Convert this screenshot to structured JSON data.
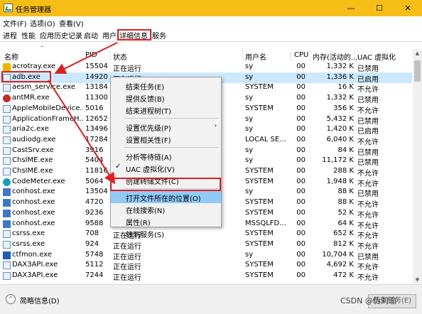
{
  "window": {
    "title": "任务管理器",
    "minimize": "—",
    "maximize": "☐",
    "close": "✕"
  },
  "menu": [
    "文件(F)",
    "选项(O)",
    "查看(V)"
  ],
  "tabs": [
    "进程",
    "性能",
    "应用历史记录",
    "启动",
    "用户",
    "详细信息",
    "服务"
  ],
  "active_tab": "详细信息",
  "columns": [
    "名称",
    "PID",
    "状态",
    "用户名",
    "CPU",
    "内存(活动的...",
    "UAC 虚拟化"
  ],
  "rows": [
    {
      "icon": "ri-yel",
      "name": "acrotray.exe",
      "pid": "15504",
      "status": "正在运行",
      "user": "sy",
      "cpu": "00",
      "mem": "1,332 K",
      "uac": "已禁用"
    },
    {
      "icon": "ri-gen",
      "name": "adb.exe",
      "pid": "14920",
      "status": "正在运行",
      "user": "sy",
      "cpu": "00",
      "mem": "1,336 K",
      "uac": "已启用",
      "selected": true
    },
    {
      "icon": "ri-gen",
      "name": "aesm_service.exe",
      "pid": "13184",
      "status": "",
      "user": "SYSTEM",
      "cpu": "00",
      "mem": "16 K",
      "uac": "不允许"
    },
    {
      "icon": "ri-red",
      "name": "antMR.exe",
      "pid": "11300",
      "status": "",
      "user": "sy",
      "cpu": "00",
      "mem": "1,332 K",
      "uac": "已禁用"
    },
    {
      "icon": "ri-gen",
      "name": "AppleMobileDevice...",
      "pid": "5016",
      "status": "",
      "user": "SYSTEM",
      "cpu": "00",
      "mem": "356 K",
      "uac": "不允许"
    },
    {
      "icon": "ri-gen",
      "name": "ApplicationFrameH...",
      "pid": "12652",
      "status": "",
      "user": "sy",
      "cpu": "00",
      "mem": "5,432 K",
      "uac": "已禁用"
    },
    {
      "icon": "ri-gen",
      "name": "aria2c.exe",
      "pid": "13496",
      "status": "",
      "user": "sy",
      "cpu": "00",
      "mem": "1,420 K",
      "uac": "已启用"
    },
    {
      "icon": "ri-gen",
      "name": "audiodg.exe",
      "pid": "17284",
      "status": "",
      "user": "LOCAL SE...",
      "cpu": "00",
      "mem": "6,040 K",
      "uac": "不允许"
    },
    {
      "icon": "ri-gen",
      "name": "CastSrv.exe",
      "pid": "3916",
      "status": "",
      "user": "sy",
      "cpu": "00",
      "mem": "84 K",
      "uac": "已禁用"
    },
    {
      "icon": "ri-gen",
      "name": "ChsIME.exe",
      "pid": "5404",
      "status": "",
      "user": "sy",
      "cpu": "00",
      "mem": "11,172 K",
      "uac": "已禁用"
    },
    {
      "icon": "ri-gen",
      "name": "ChsIME.exe",
      "pid": "11816",
      "status": "",
      "user": "SYSTEM",
      "cpu": "00",
      "mem": "288 K",
      "uac": "不允许"
    },
    {
      "icon": "ri-teal",
      "name": "CodeMeter.exe",
      "pid": "5064",
      "status": "",
      "user": "SYSTEM",
      "cpu": "00",
      "mem": "1,948 K",
      "uac": "不允许"
    },
    {
      "icon": "ri-sys",
      "name": "conhost.exe",
      "pid": "13504",
      "status": "",
      "user": "sy",
      "cpu": "00",
      "mem": "88 K",
      "uac": "已禁用"
    },
    {
      "icon": "ri-sys",
      "name": "conhost.exe",
      "pid": "4720",
      "status": "",
      "user": "SYSTEM",
      "cpu": "00",
      "mem": "88 K",
      "uac": "不允许"
    },
    {
      "icon": "ri-sys",
      "name": "conhost.exe",
      "pid": "9236",
      "status": "",
      "user": "SYSTEM",
      "cpu": "00",
      "mem": "52 K",
      "uac": "不允许"
    },
    {
      "icon": "ri-sys",
      "name": "conhost.exe",
      "pid": "9588",
      "status": "",
      "user": "MSSQLFD...",
      "cpu": "00",
      "mem": "64 K",
      "uac": "不允许"
    },
    {
      "icon": "ri-gen",
      "name": "csrss.exe",
      "pid": "708",
      "status": "正在运行",
      "user": "SYSTEM",
      "cpu": "00",
      "mem": "652 K",
      "uac": "不允许"
    },
    {
      "icon": "ri-gen",
      "name": "csrss.exe",
      "pid": "924",
      "status": "正在运行",
      "user": "SYSTEM",
      "cpu": "00",
      "mem": "812 K",
      "uac": "不允许"
    },
    {
      "icon": "ri-blue",
      "name": "ctfmon.exe",
      "pid": "5748",
      "status": "正在运行",
      "user": "sy",
      "cpu": "00",
      "mem": "10,704 K",
      "uac": "已禁用"
    },
    {
      "icon": "ri-gen",
      "name": "DAX3API.exe",
      "pid": "5112",
      "status": "正在运行",
      "user": "SYSTEM",
      "cpu": "00",
      "mem": "4,692 K",
      "uac": "不允许"
    },
    {
      "icon": "ri-gen",
      "name": "DAX3API.exe",
      "pid": "7244",
      "status": "正在运行",
      "user": "SYSTEM",
      "cpu": "00",
      "mem": "472 K",
      "uac": "不允许"
    }
  ],
  "context_menu": [
    {
      "label": "结束任务(E)"
    },
    {
      "label": "提供反馈(B)"
    },
    {
      "label": "结束进程树(T)"
    },
    {
      "sep": true
    },
    {
      "label": "设置优先级(P)",
      "submenu": true
    },
    {
      "label": "设置相关性(F)"
    },
    {
      "sep": true
    },
    {
      "label": "分析等待链(A)"
    },
    {
      "label": "UAC 虚拟化(V)",
      "checked": true
    },
    {
      "label": "创建转储文件(C)"
    },
    {
      "sep": true
    },
    {
      "label": "打开文件所在的位置(O)",
      "highlighted": true
    },
    {
      "label": "在线搜索(N)"
    },
    {
      "label": "属性(R)"
    },
    {
      "label": "转到服务(S)"
    }
  ],
  "footer": {
    "summary_label": "简略信息(D)",
    "end_task": "结束任务(E)",
    "watermark": "CSDN @伪刘瑜"
  },
  "annotation_color": "#e02020",
  "selection_color": "#cce8ff",
  "titlebar_color": "#f6bd16"
}
